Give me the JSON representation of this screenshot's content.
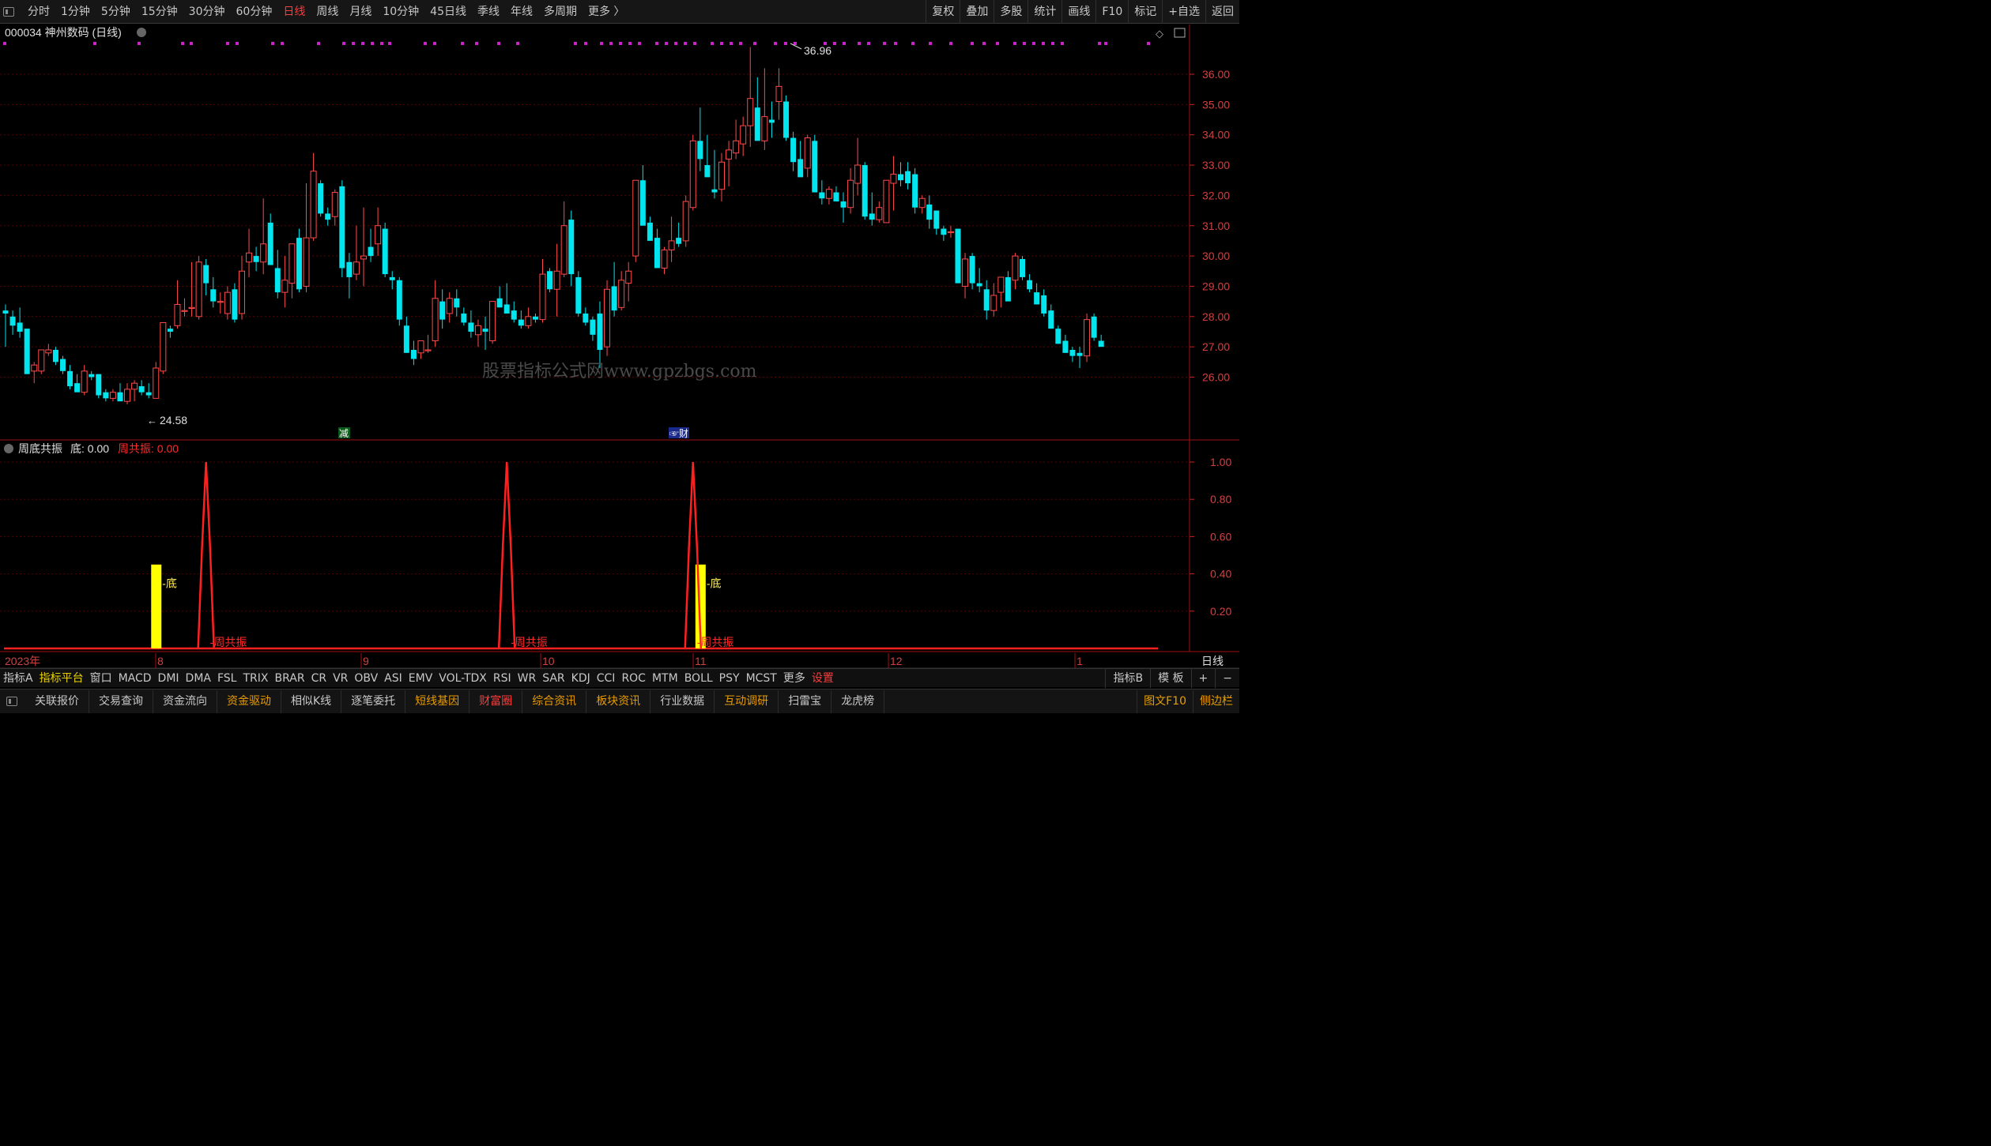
{
  "topbar": {
    "periods": [
      "分时",
      "1分钟",
      "5分钟",
      "15分钟",
      "30分钟",
      "60分钟",
      "日线",
      "周线",
      "月线",
      "10分钟",
      "45日线",
      "季线",
      "年线",
      "多周期",
      "更多 〉"
    ],
    "active_period": "日线",
    "right_buttons": [
      "复权",
      "叠加",
      "多股",
      "统计",
      "画线",
      "F10",
      "标记",
      "+自选",
      "返回"
    ]
  },
  "stock": {
    "title": "000034 神州数码 (日线)"
  },
  "main_chart": {
    "high_label": "36.96",
    "low_label": "24.58",
    "watermark": "股票指标公式网www.gpzbgs.com",
    "price_ticks": [
      "36.00",
      "35.00",
      "34.00",
      "33.00",
      "32.00",
      "31.00",
      "30.00",
      "29.00",
      "28.00",
      "27.00",
      "26.00"
    ],
    "badges": [
      {
        "text": "减",
        "color": "#0a5a1a"
      },
      {
        "text": "财",
        "color": "#1a2a8a"
      }
    ]
  },
  "indicator": {
    "title": "周底共振",
    "di_label": "底: 0.00",
    "gongzhen_label": "周共振: 0.00",
    "y_ticks": [
      "1.00",
      "0.80",
      "0.60",
      "0.40",
      "0.20"
    ],
    "di_text": "底",
    "gongzhen_text": "周共振"
  },
  "time_axis": {
    "year_label": "2023年",
    "months": [
      "8",
      "9",
      "10",
      "11",
      "12",
      "1"
    ],
    "period_label": "日线"
  },
  "colors": {
    "up": "#ff4a4a",
    "down": "#00e5ee",
    "yellow": "#ffff00",
    "red": "#ff2020",
    "grid": "#5a0000",
    "magenta": "#cc22cc"
  },
  "chart_data": {
    "type": "candlestick",
    "note_scale": "price",
    "ylim": [
      25.4,
      36.8
    ],
    "candles": [
      [
        28.2,
        28.4,
        27.0,
        28.1
      ],
      [
        28.0,
        28.2,
        27.4,
        27.7
      ],
      [
        27.8,
        28.3,
        27.3,
        27.5
      ],
      [
        27.6,
        27.6,
        26.1,
        26.1
      ],
      [
        26.2,
        26.5,
        25.8,
        26.4
      ],
      [
        26.2,
        26.9,
        26.1,
        26.9
      ],
      [
        26.8,
        27.1,
        26.7,
        26.9
      ],
      [
        26.9,
        27.0,
        26.4,
        26.5
      ],
      [
        26.6,
        26.7,
        26.1,
        26.2
      ],
      [
        26.2,
        26.4,
        25.6,
        25.7
      ],
      [
        25.8,
        26.1,
        25.6,
        25.5
      ],
      [
        25.5,
        26.4,
        25.4,
        26.2
      ],
      [
        26.1,
        26.2,
        25.9,
        26.0
      ],
      [
        26.1,
        26.1,
        25.3,
        25.4
      ],
      [
        25.5,
        25.6,
        25.2,
        25.3
      ],
      [
        25.3,
        25.6,
        25.2,
        25.5
      ],
      [
        25.5,
        25.8,
        25.4,
        25.2
      ],
      [
        25.2,
        25.8,
        25.1,
        25.6
      ],
      [
        25.6,
        25.9,
        25.2,
        25.8
      ],
      [
        25.7,
        25.9,
        25.4,
        25.5
      ],
      [
        25.5,
        25.8,
        25.3,
        25.4
      ],
      [
        25.3,
        26.5,
        25.3,
        26.3
      ],
      [
        26.2,
        27.8,
        26.1,
        27.8
      ],
      [
        27.6,
        27.7,
        27.3,
        27.5
      ],
      [
        27.7,
        29.2,
        27.6,
        28.4
      ],
      [
        28.2,
        28.6,
        28.0,
        28.2
      ],
      [
        28.3,
        29.8,
        28.0,
        28.3
      ],
      [
        28.0,
        30.0,
        27.9,
        29.8
      ],
      [
        29.7,
        29.9,
        28.7,
        29.1
      ],
      [
        28.9,
        29.3,
        28.3,
        28.5
      ],
      [
        28.5,
        28.8,
        28.1,
        28.5
      ],
      [
        28.1,
        29.0,
        27.9,
        28.8
      ],
      [
        28.9,
        29.1,
        27.8,
        27.9
      ],
      [
        28.1,
        30.0,
        27.9,
        29.5
      ],
      [
        29.8,
        30.9,
        29.3,
        30.1
      ],
      [
        30.0,
        30.3,
        29.5,
        29.8
      ],
      [
        29.8,
        31.9,
        29.4,
        30.4
      ],
      [
        31.1,
        31.4,
        29.8,
        29.7
      ],
      [
        29.6,
        30.2,
        28.6,
        28.8
      ],
      [
        28.8,
        30.0,
        28.3,
        29.2
      ],
      [
        29.1,
        30.4,
        28.6,
        30.4
      ],
      [
        30.6,
        30.9,
        28.8,
        28.9
      ],
      [
        29.0,
        32.4,
        28.8,
        30.6
      ],
      [
        30.6,
        33.4,
        30.5,
        32.8
      ],
      [
        32.4,
        32.5,
        31.3,
        31.4
      ],
      [
        31.4,
        31.6,
        31.0,
        31.2
      ],
      [
        31.3,
        32.2,
        31.0,
        32.1
      ],
      [
        32.3,
        32.5,
        29.3,
        29.6
      ],
      [
        29.8,
        30.1,
        28.6,
        29.3
      ],
      [
        29.4,
        31.0,
        29.2,
        29.8
      ],
      [
        29.9,
        31.6,
        29.0,
        30.0
      ],
      [
        30.3,
        30.9,
        29.8,
        30.0
      ],
      [
        30.4,
        31.6,
        30.0,
        31.0
      ],
      [
        30.9,
        31.1,
        29.3,
        29.4
      ],
      [
        29.3,
        29.5,
        28.9,
        29.2
      ],
      [
        29.2,
        29.3,
        27.7,
        27.9
      ],
      [
        27.7,
        28.0,
        26.8,
        26.8
      ],
      [
        26.9,
        27.2,
        26.4,
        26.6
      ],
      [
        26.8,
        27.1,
        26.6,
        27.2
      ],
      [
        26.9,
        27.4,
        26.8,
        26.9
      ],
      [
        27.2,
        29.2,
        27.0,
        28.6
      ],
      [
        28.5,
        28.9,
        27.6,
        27.9
      ],
      [
        28.1,
        28.8,
        27.8,
        28.6
      ],
      [
        28.6,
        28.9,
        28.0,
        28.3
      ],
      [
        28.1,
        28.3,
        27.7,
        27.8
      ],
      [
        27.8,
        28.2,
        27.3,
        27.5
      ],
      [
        27.4,
        27.9,
        27.0,
        27.7
      ],
      [
        27.6,
        28.0,
        26.9,
        27.5
      ],
      [
        27.2,
        28.5,
        27.1,
        28.5
      ],
      [
        28.6,
        29.0,
        28.3,
        28.3
      ],
      [
        28.4,
        29.1,
        28.2,
        28.1
      ],
      [
        28.2,
        28.5,
        27.8,
        27.9
      ],
      [
        27.9,
        28.2,
        27.6,
        27.7
      ],
      [
        27.7,
        28.3,
        27.6,
        28.0
      ],
      [
        28.0,
        28.1,
        27.8,
        27.9
      ],
      [
        27.9,
        29.9,
        27.8,
        29.4
      ],
      [
        29.5,
        29.6,
        28.8,
        28.9
      ],
      [
        28.9,
        30.4,
        28.0,
        29.5
      ],
      [
        29.4,
        31.8,
        29.3,
        31.0
      ],
      [
        31.2,
        31.5,
        29.0,
        29.4
      ],
      [
        29.3,
        29.5,
        28.0,
        28.1
      ],
      [
        28.1,
        28.3,
        27.7,
        27.8
      ],
      [
        27.9,
        28.0,
        27.2,
        27.4
      ],
      [
        28.1,
        28.5,
        26.3,
        26.9
      ],
      [
        27.0,
        29.2,
        26.7,
        28.9
      ],
      [
        29.0,
        29.8,
        28.0,
        28.2
      ],
      [
        28.3,
        29.5,
        28.2,
        29.2
      ],
      [
        29.1,
        29.8,
        28.5,
        29.5
      ],
      [
        30.0,
        32.5,
        29.8,
        32.5
      ],
      [
        32.5,
        33.0,
        31.6,
        31.0
      ],
      [
        31.1,
        31.3,
        30.5,
        30.5
      ],
      [
        30.6,
        30.9,
        29.6,
        29.6
      ],
      [
        29.6,
        30.3,
        29.4,
        30.2
      ],
      [
        30.2,
        31.3,
        29.8,
        30.5
      ],
      [
        30.6,
        31.1,
        30.3,
        30.4
      ],
      [
        30.5,
        32.0,
        30.3,
        31.8
      ],
      [
        31.6,
        34.0,
        31.5,
        33.8
      ],
      [
        33.8,
        34.9,
        32.8,
        33.2
      ],
      [
        33.0,
        34.0,
        32.7,
        32.6
      ],
      [
        32.2,
        33.5,
        31.9,
        32.1
      ],
      [
        32.2,
        33.4,
        31.8,
        33.1
      ],
      [
        33.2,
        33.8,
        32.3,
        33.5
      ],
      [
        33.4,
        34.5,
        33.2,
        33.8
      ],
      [
        33.7,
        34.6,
        33.3,
        34.3
      ],
      [
        34.3,
        36.9,
        33.6,
        35.2
      ],
      [
        34.9,
        35.9,
        33.9,
        33.8
      ],
      [
        33.8,
        36.2,
        33.5,
        34.6
      ],
      [
        34.5,
        35.1,
        33.9,
        34.4
      ],
      [
        35.1,
        36.2,
        34.5,
        35.6
      ],
      [
        35.1,
        35.3,
        33.8,
        33.9
      ],
      [
        33.9,
        34.1,
        32.8,
        33.1
      ],
      [
        33.2,
        33.8,
        32.9,
        32.6
      ],
      [
        32.9,
        34.0,
        32.6,
        33.9
      ],
      [
        33.8,
        34.0,
        32.2,
        32.1
      ],
      [
        32.1,
        32.5,
        31.7,
        31.9
      ],
      [
        31.9,
        32.3,
        31.7,
        32.2
      ],
      [
        32.1,
        32.3,
        31.8,
        31.8
      ],
      [
        31.8,
        32.1,
        31.1,
        31.6
      ],
      [
        31.6,
        32.9,
        31.4,
        32.5
      ],
      [
        32.4,
        33.9,
        32.0,
        33.0
      ],
      [
        33.0,
        33.1,
        31.2,
        31.3
      ],
      [
        31.4,
        32.1,
        31.0,
        31.2
      ],
      [
        31.2,
        31.8,
        31.1,
        31.6
      ],
      [
        31.1,
        32.1,
        31.1,
        32.5
      ],
      [
        32.4,
        33.3,
        31.5,
        32.7
      ],
      [
        32.7,
        33.1,
        32.3,
        32.5
      ],
      [
        32.8,
        33.1,
        32.2,
        32.4
      ],
      [
        32.7,
        32.9,
        31.4,
        31.6
      ],
      [
        31.6,
        32.0,
        31.4,
        31.9
      ],
      [
        31.7,
        32.0,
        30.9,
        31.2
      ],
      [
        31.5,
        31.5,
        30.7,
        30.9
      ],
      [
        30.9,
        31.0,
        30.5,
        30.7
      ],
      [
        30.8,
        31.0,
        30.6,
        30.8
      ],
      [
        30.9,
        30.9,
        29.1,
        29.1
      ],
      [
        29.0,
        30.1,
        28.6,
        29.9
      ],
      [
        30.0,
        30.1,
        28.9,
        29.1
      ],
      [
        29.1,
        29.6,
        28.8,
        29.0
      ],
      [
        28.9,
        29.2,
        27.9,
        28.2
      ],
      [
        28.2,
        29.1,
        28.0,
        28.7
      ],
      [
        28.8,
        29.2,
        28.3,
        29.3
      ],
      [
        29.3,
        29.5,
        28.6,
        28.5
      ],
      [
        29.2,
        30.1,
        28.9,
        30.0
      ],
      [
        29.9,
        30.0,
        29.2,
        29.3
      ],
      [
        29.2,
        29.4,
        28.8,
        28.9
      ],
      [
        28.8,
        29.1,
        28.4,
        28.4
      ],
      [
        28.7,
        28.9,
        28.0,
        28.1
      ],
      [
        28.2,
        28.4,
        27.6,
        27.6
      ],
      [
        27.6,
        27.7,
        27.1,
        27.1
      ],
      [
        27.2,
        27.4,
        26.8,
        26.8
      ],
      [
        26.9,
        27.0,
        26.5,
        26.7
      ],
      [
        26.8,
        27.0,
        26.3,
        26.7
      ],
      [
        26.7,
        28.1,
        26.5,
        27.9
      ],
      [
        28.0,
        28.1,
        27.2,
        27.3
      ],
      [
        27.2,
        27.4,
        27.0,
        27.0
      ]
    ],
    "indicator_series": {
      "di": [
        {
          "index": 21,
          "value": 0.45
        },
        {
          "index": 97,
          "value": 0.45
        },
        {
          "index": 173,
          "value": 0.45
        }
      ],
      "gongzhen": [
        {
          "index": 28,
          "value": 1.0
        },
        {
          "index": 70,
          "value": 1.0
        },
        {
          "index": 96,
          "value": 1.0
        }
      ]
    }
  }
}
